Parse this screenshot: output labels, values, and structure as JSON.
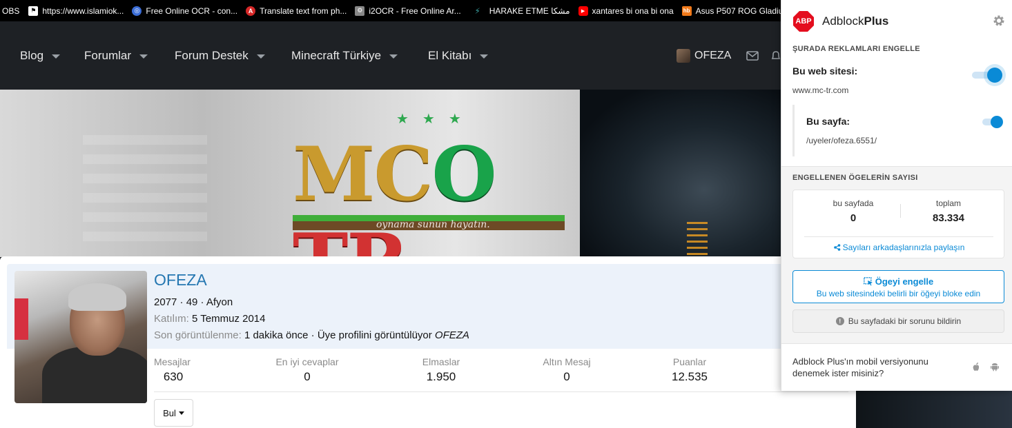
{
  "bookmarks": [
    {
      "label": "OBS",
      "icon": "obs-icon",
      "color": "#000000"
    },
    {
      "label": "https://www.islamiok...",
      "icon": "islamiok-icon",
      "color": "#ffffff"
    },
    {
      "label": "Free Online OCR - con...",
      "icon": "ocr-icon",
      "color": "#3b6dd6"
    },
    {
      "label": "Translate text from ph...",
      "icon": "translate-icon",
      "color": "#d62828"
    },
    {
      "label": "i2OCR - Free Online Ar...",
      "icon": "i2ocr-icon",
      "color": "#888888"
    },
    {
      "label": "HARAKE ETME مشكا",
      "icon": "harake-icon",
      "color": "#3aa0a0"
    },
    {
      "label": "xantares bi ona bi ona",
      "icon": "youtube-icon",
      "color": "#ff0000"
    },
    {
      "label": "Asus P507 ROG Gladiu...",
      "icon": "hb-icon",
      "color": "#f27a1a"
    }
  ],
  "nav": {
    "items": [
      "Blog",
      "Forumlar",
      "Forum Destek",
      "Minecraft Türkiye",
      "El Kitabı"
    ],
    "user": "OFEZA"
  },
  "banner": {
    "logo_mc": "MC",
    "logo_o": "O",
    "logo_tr": "TR",
    "tagline": "oynama sunun hayatın."
  },
  "profile": {
    "username": "OFEZA",
    "meta": "2077 · 49 · Afyon",
    "joined_label": "Katılım:",
    "joined_value": "5 Temmuz 2014",
    "seen_label": "Son görüntülenme:",
    "seen_value": "1 dakika önce · Üye profilini görüntülüyor",
    "seen_user": "OFEZA",
    "stats": [
      {
        "label": "Mesajlar",
        "value": "630"
      },
      {
        "label": "En iyi cevaplar",
        "value": "0"
      },
      {
        "label": "Elmaslar",
        "value": "1.950"
      },
      {
        "label": "Altın Mesaj",
        "value": "0"
      },
      {
        "label": "Puanlar",
        "value": "12.535"
      }
    ],
    "find_label": "Bul"
  },
  "abp": {
    "logo": "ABP",
    "title_a": "Adblock",
    "title_b": "Plus",
    "section1": "ŞURADA REKLAMLARI ENGELLE",
    "site_label": "Bu web sitesi:",
    "site_value": "www.mc-tr.com",
    "page_label": "Bu sayfa:",
    "page_value": "/uyeler/ofeza.6551/",
    "section2": "ENGELLENEN ÖGELERİN SAYISI",
    "count_page_label": "bu sayfada",
    "count_page_value": "0",
    "count_total_label": "toplam",
    "count_total_value": "83.334",
    "share_label": "Sayıları arkadaşlarınızla paylaşın",
    "block_title": "Ögeyi engelle",
    "block_sub": "Bu web sitesindeki belirli bir öğeyi bloke edin",
    "report_label": "Bu sayfadaki bir sorunu bildirin",
    "mobile_text": "Adblock Plus'ın mobil versiyonunu denemek ister misiniz?",
    "site_toggle_on": true,
    "page_toggle_on": true,
    "accent": "#0a8ad6",
    "brand": "#e40d1e"
  }
}
